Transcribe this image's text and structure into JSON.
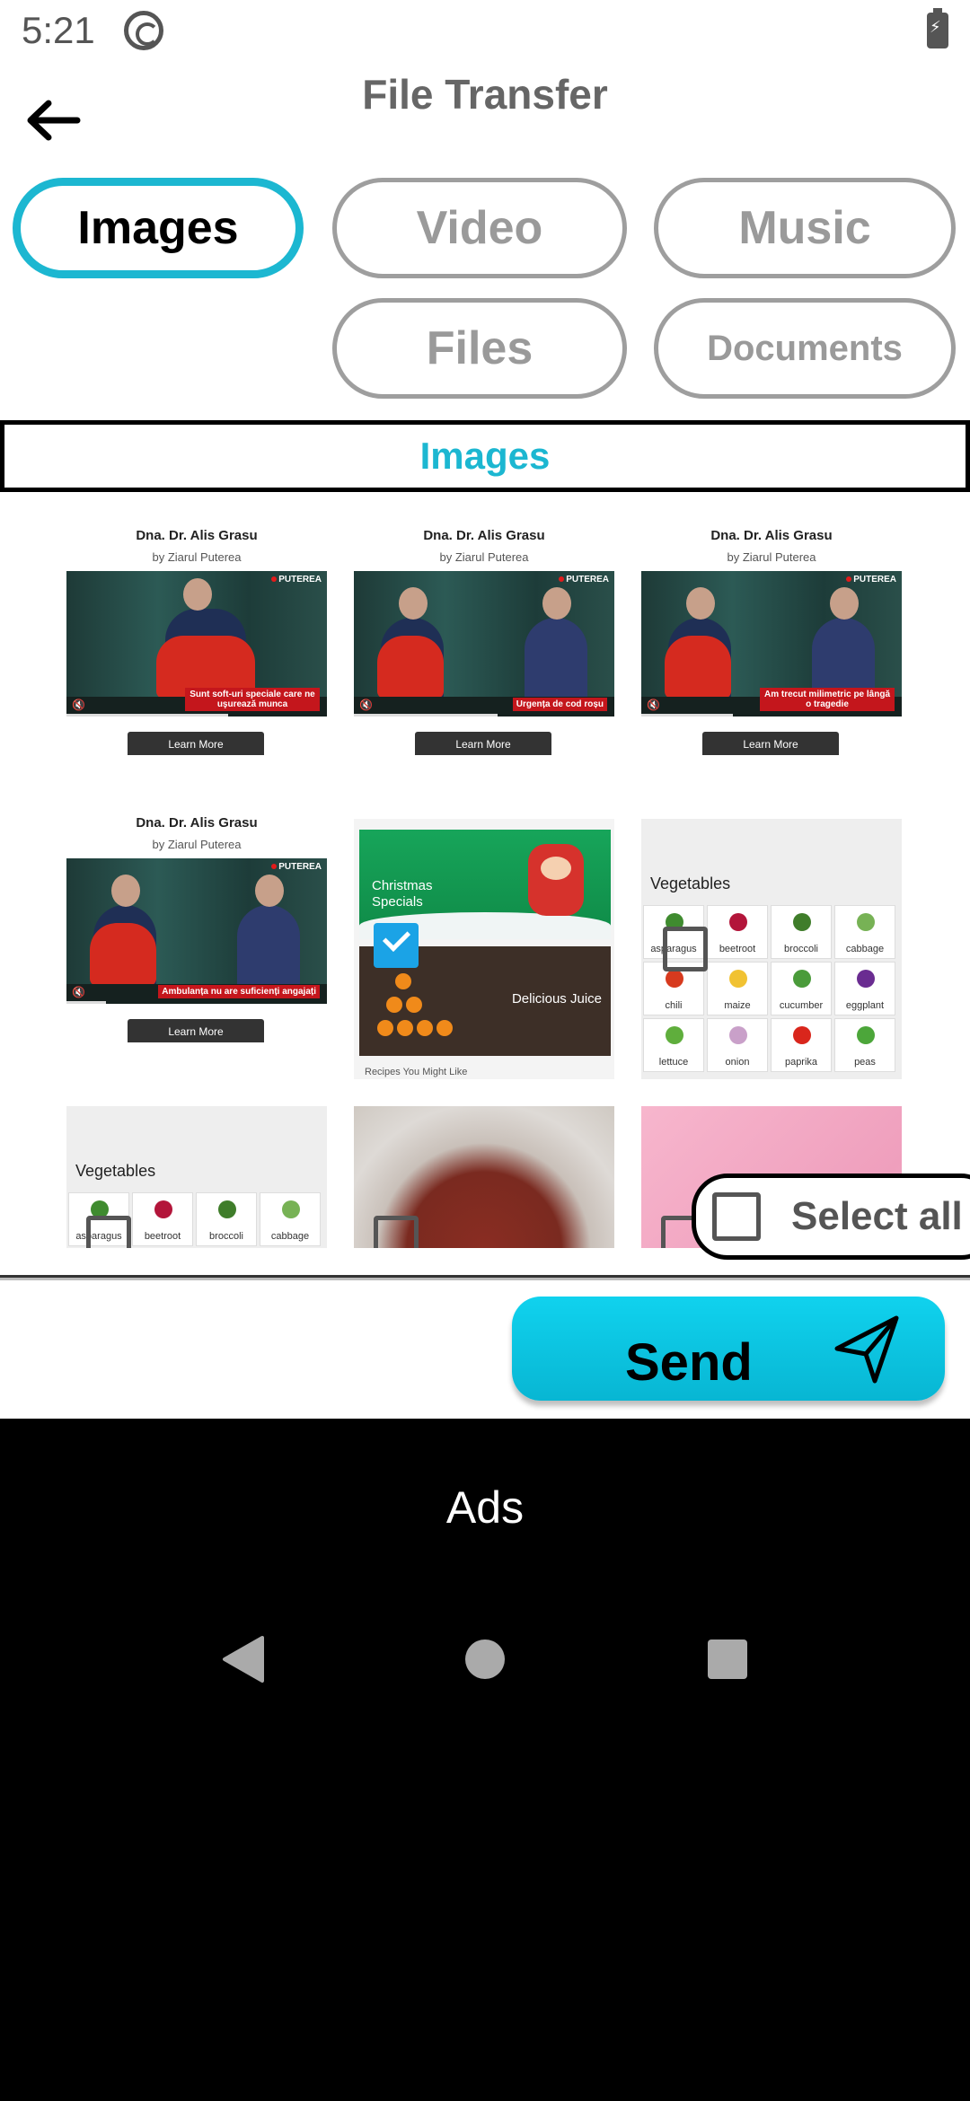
{
  "status_bar": {
    "time": "5:21"
  },
  "header": {
    "title": "File Transfer"
  },
  "tabs": [
    {
      "label": "Images",
      "active": true
    },
    {
      "label": "Video",
      "active": false
    },
    {
      "label": "Music",
      "active": false
    },
    {
      "label": "Files",
      "active": false
    },
    {
      "label": "Documents",
      "active": false
    }
  ],
  "section_title": "Images",
  "grid": {
    "ads": [
      {
        "title": "Dna. Dr. Alis Grasu",
        "subtitle": "by Ziarul Puterea",
        "logo": "PUTEREA",
        "caption": "Sunt soft-uri speciale care ne uşurează munca",
        "button": "Learn More"
      },
      {
        "title": "Dna. Dr. Alis Grasu",
        "subtitle": "by Ziarul Puterea",
        "logo": "PUTEREA",
        "caption": "Urgența de cod roșu",
        "button": "Learn More"
      },
      {
        "title": "Dna. Dr. Alis Grasu",
        "subtitle": "by Ziarul Puterea",
        "logo": "PUTEREA",
        "caption": "Am trecut milimetric pe lângă o tragedie",
        "button": "Learn More"
      },
      {
        "title": "Dna. Dr. Alis Grasu",
        "subtitle": "by Ziarul Puterea",
        "logo": "PUTEREA",
        "caption": "Ambulanța nu are suficienți angajați",
        "button": "Learn More"
      }
    ],
    "xmas": {
      "top_label": "Christmas Specials",
      "bottom_label": "Delicious Juice",
      "more_text": "Recipes You Might Like",
      "checked": true
    },
    "vegetables": {
      "title": "Vegetables",
      "items": [
        "asparagus",
        "beetroot",
        "broccoli",
        "cabbage",
        "chili",
        "maize",
        "cucumber",
        "eggplant",
        "lettuce",
        "onion",
        "paprika",
        "peas"
      ],
      "colors": [
        "#3f8b2f",
        "#b3153a",
        "#3f7d2a",
        "#77b255",
        "#d73a1e",
        "#f1c232",
        "#4a9b3a",
        "#6a2c91",
        "#5fae3c",
        "#c9a0c9",
        "#d9261c",
        "#4ca63a"
      ]
    }
  },
  "select_all_label": "Select all",
  "send_label": "Send",
  "ads_label": "Ads"
}
